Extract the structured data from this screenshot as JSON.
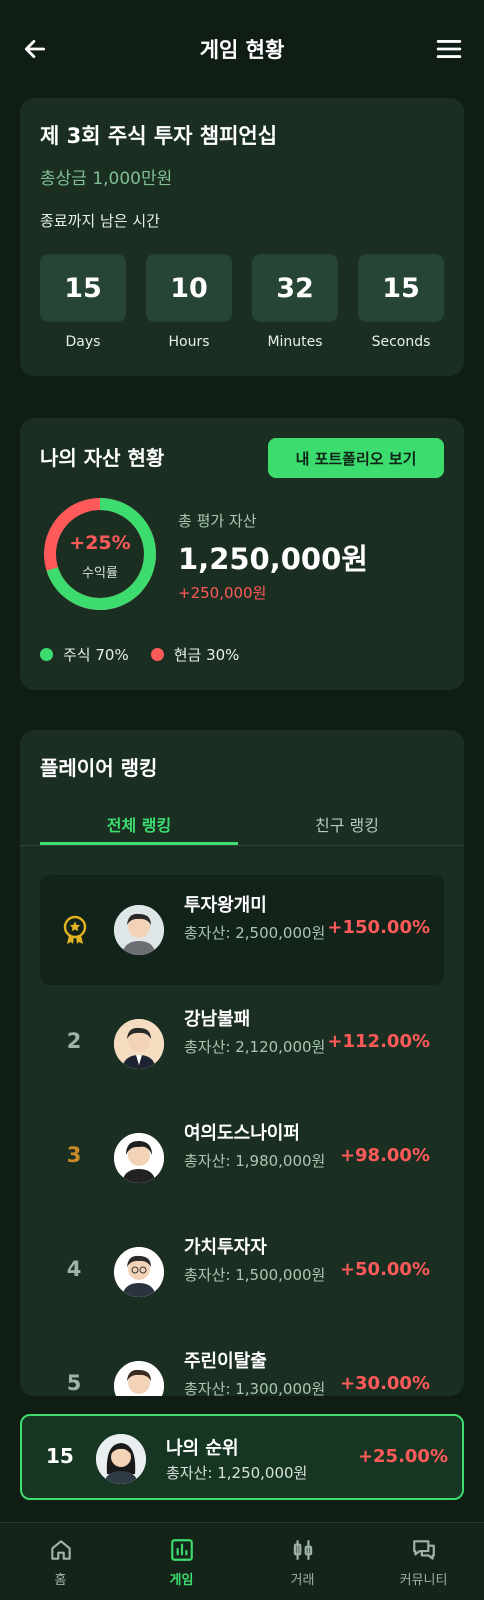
{
  "header": {
    "title": "게임 현황"
  },
  "tournament": {
    "title": "제 3회 주식 투자 챔피언십",
    "prize": "총상금 1,000만원",
    "remaining_label": "종료까지 남은 시간",
    "countdown": [
      {
        "value": "15",
        "label": "Days"
      },
      {
        "value": "10",
        "label": "Hours"
      },
      {
        "value": "32",
        "label": "Minutes"
      },
      {
        "value": "15",
        "label": "Seconds"
      }
    ]
  },
  "assets": {
    "title": "나의 자산 현황",
    "portfolio_button": "내 포트폴리오 보기",
    "return_pct": "+25%",
    "return_label": "수익률",
    "total_label": "총 평가 자산",
    "total_value": "1,250,000원",
    "total_change": "+250,000원",
    "allocation": [
      {
        "label": "주식 70%",
        "fraction": 0.7,
        "color": "#3ddc6f"
      },
      {
        "label": "현금 30%",
        "fraction": 0.3,
        "color": "#ff5a5a"
      }
    ]
  },
  "ranking": {
    "title": "플레이어 랭킹",
    "tabs": [
      "전체 랭킹",
      "친구 랭킹"
    ],
    "rows": [
      {
        "rank": "1",
        "name": "투자왕개미",
        "asset": "총자산: 2,500,000원",
        "return": "+150.00%"
      },
      {
        "rank": "2",
        "name": "강남불패",
        "asset": "총자산: 2,120,000원",
        "return": "+112.00%"
      },
      {
        "rank": "3",
        "name": "여의도스나이퍼",
        "asset": "총자산: 1,980,000원",
        "return": "+98.00%"
      },
      {
        "rank": "4",
        "name": "가치투자자",
        "asset": "총자산: 1,500,000원",
        "return": "+50.00%"
      },
      {
        "rank": "5",
        "name": "주린이탈출",
        "asset": "총자산: 1,300,000원",
        "return": "+30.00%"
      }
    ]
  },
  "my_rank": {
    "rank": "15",
    "label": "나의 순위",
    "asset": "총자산: 1,250,000원",
    "return": "+25.00%"
  },
  "nav": [
    {
      "label": "홈",
      "icon": "home-icon"
    },
    {
      "label": "게임",
      "icon": "bar-chart-icon"
    },
    {
      "label": "거래",
      "icon": "candlestick-icon"
    },
    {
      "label": "커뮤니티",
      "icon": "chat-icon"
    }
  ],
  "colors": {
    "accent": "#3ddc6f",
    "negative": "#ff5a5a",
    "background": "#0f1d15",
    "card": "#1a2e22"
  }
}
